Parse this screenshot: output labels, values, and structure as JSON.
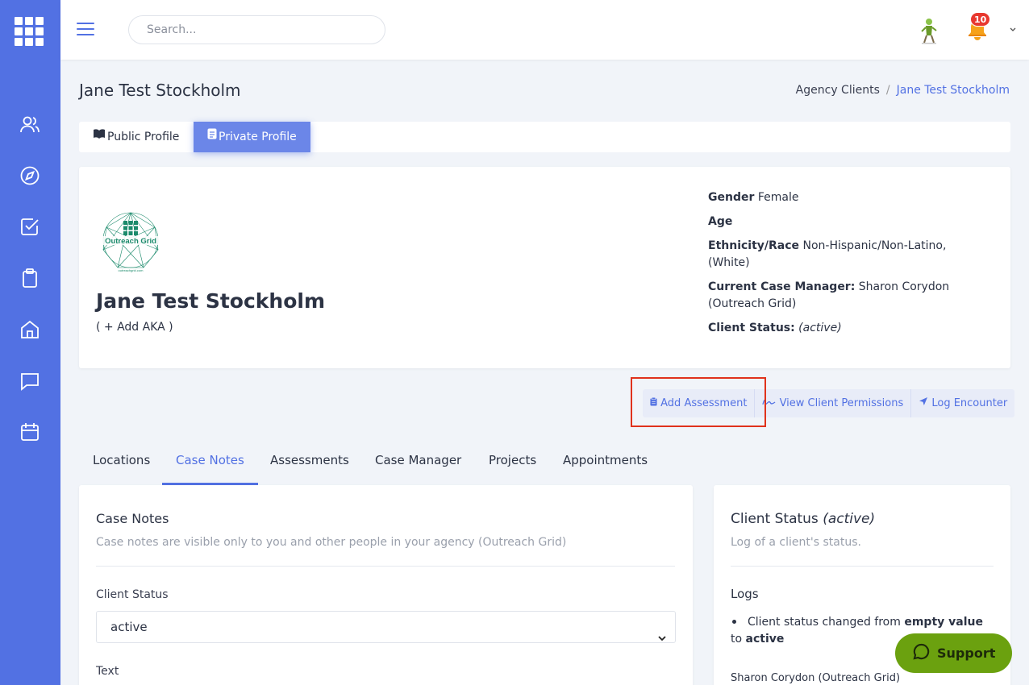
{
  "search": {
    "placeholder": "Search..."
  },
  "notifications": {
    "count": "10"
  },
  "header": {
    "title": "Jane Test Stockholm",
    "breadcrumb": [
      "Agency Clients",
      "Jane Test Stockholm"
    ],
    "breadcrumb_sep": "/"
  },
  "profile_tabs": [
    {
      "label": "Public Profile",
      "icon": "book-icon"
    },
    {
      "label": "Private Profile",
      "icon": "document-icon",
      "active": true
    }
  ],
  "profile": {
    "name": "Jane Test Stockholm",
    "aka": "( + Add AKA )",
    "logo_text": "Outreach Grid",
    "logo_url_text": "outreachgrid.com",
    "gender_label": "Gender",
    "gender": "Female",
    "age_label": "Age",
    "ethnicity_label": "Ethnicity/Race",
    "ethnicity": "Non-Hispanic/Non-Latino, (White)",
    "case_manager_label": "Current Case Manager:",
    "case_manager": "Sharon Corydon (Outreach Grid)",
    "status_label": "Client Status:",
    "status": "(active)"
  },
  "actions": [
    {
      "label": "Add Assessment",
      "icon": "clipboard-icon"
    },
    {
      "label": "View Client Permissions",
      "icon": "signature-icon"
    },
    {
      "label": "Log Encounter",
      "icon": "location-arrow-icon"
    }
  ],
  "section_tabs": [
    "Locations",
    "Case Notes",
    "Assessments",
    "Case Manager",
    "Projects",
    "Appointments"
  ],
  "active_section_tab": "Case Notes",
  "case_notes": {
    "title": "Case Notes",
    "subtitle": "Case notes are visible only to you and other people in your agency (Outreach Grid)",
    "status_label": "Client Status",
    "status_value": "active",
    "text_label": "Text"
  },
  "client_status_card": {
    "title": "Client Status",
    "title_status": "(active)",
    "subtitle": "Log of a client's status.",
    "logs_label": "Logs",
    "log_pre": "Client status changed from",
    "log_from": "empty value",
    "log_mid": "to",
    "log_to": "active",
    "log_user": "Sharon Corydon (Outreach Grid)"
  },
  "support": {
    "label": "Support"
  },
  "colors": {
    "accent": "#5271e3",
    "sidebar": "#5271e3",
    "highlight": "#e0321c",
    "support": "#6ba10f"
  }
}
